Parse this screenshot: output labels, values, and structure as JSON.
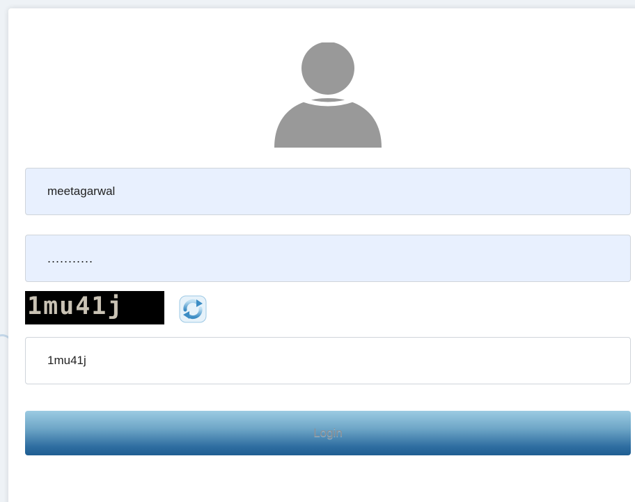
{
  "login_form": {
    "username_value": "meetagarwal",
    "password_value": "...........",
    "captcha_text": "1mu41j",
    "captcha_input_value": "1mu41j",
    "login_label": "Login"
  },
  "icons": {
    "avatar": "user-silhouette-icon",
    "refresh": "refresh-captcha-icon"
  },
  "colors": {
    "autofill_background": "#e8f0fe",
    "login_gradient_top": "#9ccbe2",
    "login_gradient_bottom": "#1f5e92",
    "avatar_gray": "#999999"
  }
}
